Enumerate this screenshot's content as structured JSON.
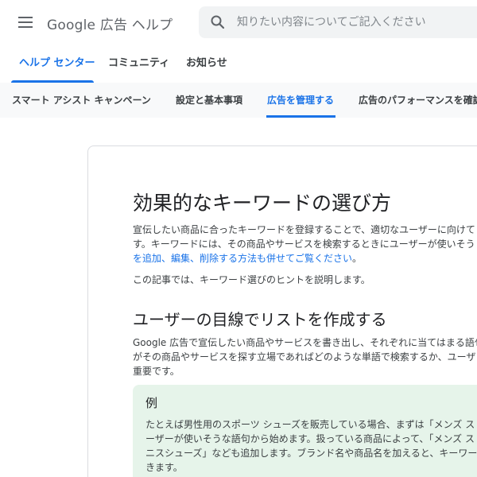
{
  "header": {
    "product_title": "Google 広告 ヘルプ",
    "search_placeholder": "知りたい内容についてご記入ください"
  },
  "primary_tabs": [
    {
      "label": "ヘルプ センター",
      "active": true
    },
    {
      "label": "コミュニティ",
      "active": false
    },
    {
      "label": "お知らせ",
      "active": false
    }
  ],
  "secondary_nav": [
    {
      "label": "スマート アシスト キャンペーン",
      "active": false
    },
    {
      "label": "設定と基本事項",
      "active": false
    },
    {
      "label": "広告を管理する",
      "active": true
    },
    {
      "label": "広告のパフォーマンスを確認",
      "active": false
    }
  ],
  "article": {
    "title": "効果的なキーワードの選び方",
    "intro_line1": "宣伝したい商品に合ったキーワードを登録することで、適切なユーザーに向けて",
    "intro_line2": "す。キーワードには、その商品やサービスを検索するときにユーザーが使いそう",
    "intro_link": "を追加、編集、削除する方法も併せてご覧ください",
    "intro_link_suffix": "。",
    "summary": "この記事では、キーワード選びのヒントを説明します。",
    "section_heading": "ユーザーの目線でリストを作成する",
    "section_line1": "Google 広告で宣伝したい商品やサービスを書き出し、それぞれに当てはまる語句",
    "section_line2": "がその商品やサービスを探す立場であればどのような単語で検索するか、ユーザ",
    "section_line3": "重要です。",
    "example": {
      "title": "例",
      "line1": "たとえば男性用のスポーツ シューズを販売している場合、まずは「メンズ ス",
      "line2": "ーザーが使いそうな語句から始めます。扱っている商品によって、「メンズ ス",
      "line3": "ニスシューズ」なども追加します。ブランド名や商品名を加えると、キーワー",
      "line4": "きます。"
    }
  },
  "colors": {
    "accent": "#1a73e8",
    "example_bg": "#e6f4ea",
    "nav_bg": "#f8f9fa"
  },
  "icons": {
    "menu": "hamburger-menu-icon",
    "search": "search-icon"
  }
}
